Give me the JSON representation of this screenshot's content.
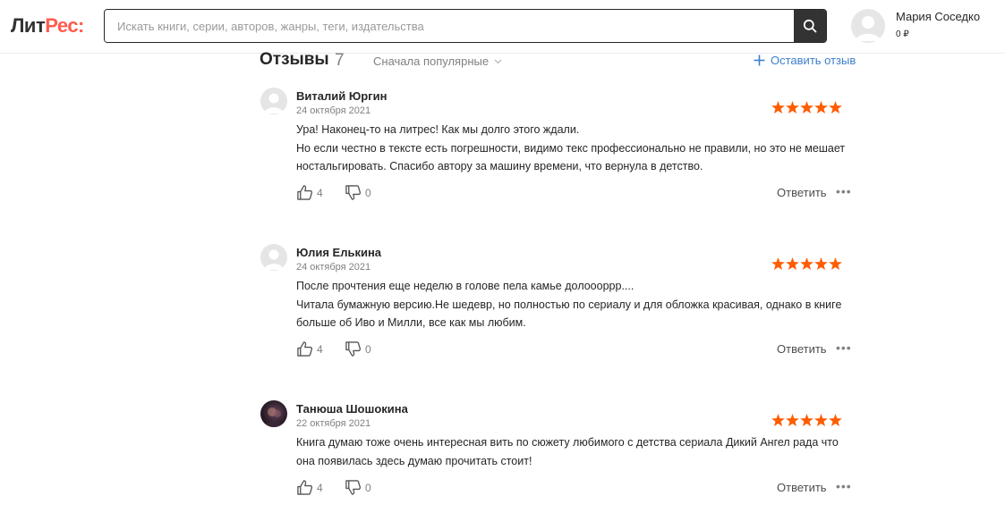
{
  "header": {
    "logo_part1": "Лит",
    "logo_part2": "Рес:",
    "search_placeholder": "Искать книги, серии, авторов, жанры, теги, издательства",
    "user_name": "Мария Соседко",
    "user_balance": "0 ₽"
  },
  "reviews": {
    "title": "Отзывы",
    "count": "7",
    "sort_label": "Сначала популярные",
    "add_label": "Оставить отзыв",
    "items": [
      {
        "name": "Виталий Юргин",
        "date": "24 октября 2021",
        "rating": 5,
        "lines": [
          "Ура! Наконец-то на литрес! Как мы долго этого ждали.",
          "Но если честно в тексте есть погрешности, видимо текс профессионально не правили, но это не мешает",
          "ностальгировать. Спасибо автору за машину времени, что вернула в детство."
        ],
        "likes": "4",
        "dislikes": "0",
        "reply_label": "Ответить",
        "more_label": "•••"
      },
      {
        "name": "Юлия Елькина",
        "date": "24 октября 2021",
        "rating": 5,
        "lines": [
          "После прочтения еще неделю в голове пела камье дoлooоррр....",
          "Читала бумажную версию.Не шедевр, но полностью по сериалу и для обложка красивая, однако в книге",
          "больше об Иво и Милли, все как мы любим."
        ],
        "likes": "4",
        "dislikes": "0",
        "reply_label": "Ответить",
        "more_label": "•••"
      },
      {
        "name": "Танюша Шошокина",
        "date": "22 октября 2021",
        "rating": 5,
        "lines": [
          "Книга думаю тоже очень интересная вить по сюжету любимого с детства сериала Дикий Ангел рада что",
          "она появилась здесь думаю прочитать стоит!"
        ],
        "likes": "4",
        "dislikes": "0",
        "reply_label": "Ответить",
        "more_label": "•••"
      }
    ]
  },
  "colors": {
    "accent_star": "#ff5c00",
    "logo_accent": "#ff5c4d",
    "link_blue": "#3d7fcc"
  }
}
